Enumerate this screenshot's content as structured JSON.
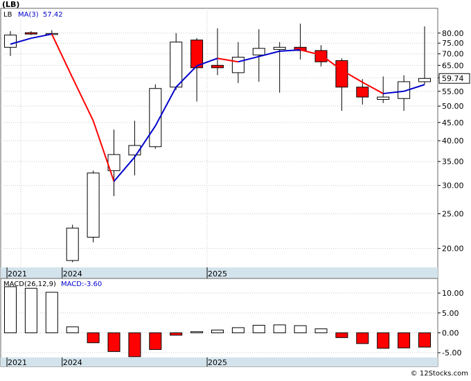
{
  "chart_data": [
    {
      "type": "candlestick",
      "title": "(LB)",
      "scale": "log",
      "ylim": [
        17.7,
        93
      ],
      "legend": {
        "symbol": "LB",
        "ma_label": "MA(3)",
        "ma_value": "57.42"
      },
      "last_price_label": "59.74",
      "y_ticks": [
        {
          "value": 80,
          "label": "80.00"
        },
        {
          "value": 75,
          "label": "75.00"
        },
        {
          "value": 70,
          "label": "70.00"
        },
        {
          "value": 65,
          "label": "65.00"
        },
        {
          "value": 60,
          "label": "60.00"
        },
        {
          "value": 55,
          "label": "55.00"
        },
        {
          "value": 50,
          "label": "50.00"
        },
        {
          "value": 45,
          "label": "45.00"
        },
        {
          "value": 40,
          "label": "40.00"
        },
        {
          "value": 35,
          "label": "35.00"
        },
        {
          "value": 30,
          "label": "30.00"
        },
        {
          "value": 25,
          "label": "25.00"
        },
        {
          "value": 20,
          "label": "20.00"
        }
      ],
      "x_labels": [
        {
          "index": 0,
          "label": "2021"
        },
        {
          "index": 3,
          "label": "2024"
        },
        {
          "index": 10,
          "label": "2025"
        }
      ],
      "candles": [
        {
          "o": 73.0,
          "h": 81.0,
          "l": 69.0,
          "c": 79.0
        },
        {
          "o": 80.2,
          "h": 81.0,
          "l": 79.0,
          "c": 79.5
        },
        {
          "o": 79.5,
          "h": 81.5,
          "l": 79.0,
          "c": 79.8
        },
        {
          "o": 18.5,
          "h": 23.3,
          "l": 18.3,
          "c": 22.8
        },
        {
          "o": 21.5,
          "h": 33.0,
          "l": 20.8,
          "c": 32.5
        },
        {
          "o": 33.0,
          "h": 43.0,
          "l": 28.0,
          "c": 36.6
        },
        {
          "o": 36.5,
          "h": 45.5,
          "l": 32.0,
          "c": 38.8
        },
        {
          "o": 38.5,
          "h": 57.5,
          "l": 38.0,
          "c": 56.0
        },
        {
          "o": 56.5,
          "h": 80.0,
          "l": 55.5,
          "c": 75.5
        },
        {
          "o": 76.5,
          "h": 77.5,
          "l": 51.5,
          "c": 64.0
        },
        {
          "o": 65.0,
          "h": 82.5,
          "l": 61.0,
          "c": 64.0
        },
        {
          "o": 62.0,
          "h": 75.5,
          "l": 58.0,
          "c": 68.5
        },
        {
          "o": 69.5,
          "h": 82.0,
          "l": 58.5,
          "c": 72.5
        },
        {
          "o": 72.0,
          "h": 75.5,
          "l": 54.5,
          "c": 73.0
        },
        {
          "o": 73.0,
          "h": 85.0,
          "l": 67.5,
          "c": 71.5
        },
        {
          "o": 71.5,
          "h": 74.0,
          "l": 64.5,
          "c": 66.5
        },
        {
          "o": 67.0,
          "h": 68.0,
          "l": 48.5,
          "c": 56.5
        },
        {
          "o": 56.5,
          "h": 59.5,
          "l": 50.5,
          "c": 53.0
        },
        {
          "o": 52.2,
          "h": 60.5,
          "l": 51.0,
          "c": 53.0
        },
        {
          "o": 52.5,
          "h": 61.0,
          "l": 48.5,
          "c": 58.5
        },
        {
          "o": 58.5,
          "h": 83.5,
          "l": 57.5,
          "c": 59.74
        }
      ],
      "ma_series": [
        74.5,
        77.4,
        79.5,
        60.0,
        45.5,
        30.8,
        36.0,
        44.0,
        56.5,
        64.8,
        68.0,
        66.5,
        68.8,
        71.2,
        71.8,
        69.5,
        63.0,
        58.3,
        54.2,
        55.0,
        57.42
      ],
      "colors": {
        "up_fill": "#ffffff",
        "down_fill": "#ff0000",
        "ma_up": "#0000cc",
        "ma_down": "#ff0000",
        "axis_strip": "#d3e3ec",
        "grid": "#c8c8c8"
      }
    },
    {
      "type": "bar",
      "title": "MACD(26,12,9)",
      "value_label": "MACD:-3.60",
      "ylim": [
        -6.2,
        13.5
      ],
      "y_ticks": [
        {
          "value": 10,
          "label": "10.00"
        },
        {
          "value": 5,
          "label": "5.00"
        },
        {
          "value": 0,
          "label": "0.00"
        },
        {
          "value": -5,
          "label": "-5.00"
        }
      ],
      "x_labels": [
        {
          "index": 0,
          "label": "2021"
        },
        {
          "index": 3,
          "label": "2024"
        },
        {
          "index": 10,
          "label": "2025"
        }
      ],
      "values": [
        11.6,
        11.2,
        10.2,
        1.5,
        -2.5,
        -4.7,
        -6.0,
        -4.2,
        -0.6,
        0.3,
        0.7,
        1.3,
        1.9,
        2.0,
        1.8,
        1.0,
        -1.2,
        -2.7,
        -3.9,
        -3.8,
        -3.6
      ],
      "colors": {
        "positive": "#ffffff",
        "negative": "#ff0000"
      }
    }
  ],
  "footer": {
    "credit": "© 12Stocks.com"
  }
}
